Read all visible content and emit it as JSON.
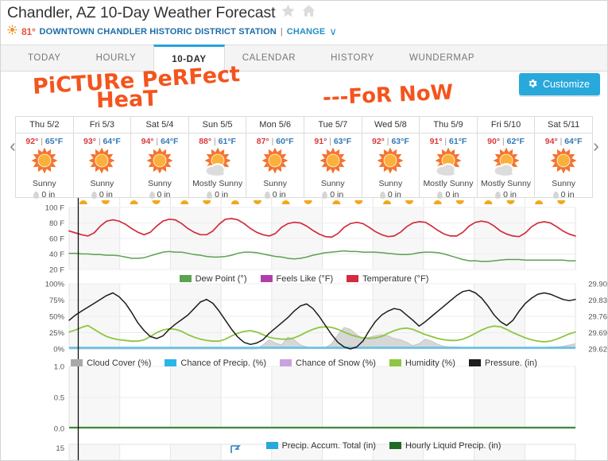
{
  "header": {
    "title": "Chandler, AZ 10-Day Weather Forecast",
    "star_icon": "star-icon",
    "home_icon": "home-icon",
    "current_temp": "81°",
    "sun_icon": "sun-icon",
    "station": "DOWNTOWN CHANDLER HISTORIC DISTRICT STATION",
    "separator": "|",
    "change_label": "CHANGE",
    "chevron": "∨"
  },
  "tabs": [
    {
      "label": "TODAY",
      "active": false
    },
    {
      "label": "HOURLY",
      "active": false
    },
    {
      "label": "10-DAY",
      "active": true
    },
    {
      "label": "CALENDAR",
      "active": false
    },
    {
      "label": "HISTORY",
      "active": false
    },
    {
      "label": "WUNDERMAP",
      "active": false
    }
  ],
  "annotations": [
    {
      "text": "PiCTURe PeRFect",
      "name": "annotation-picture-perfect"
    },
    {
      "text": "HeaT",
      "name": "annotation-heat"
    },
    {
      "text": "---FoR NoW",
      "name": "annotation-for-now"
    }
  ],
  "customize": {
    "label": "Customize",
    "icon": "gear-icon",
    "color": "#29a8dc"
  },
  "nav": {
    "prev": "‹",
    "next": "›"
  },
  "forecast": {
    "precip_unit": "0 in",
    "days": [
      {
        "day": "Thu 5/2",
        "high": "92°",
        "low": "65°F",
        "cond": "Sunny",
        "icon": "sunny-icon",
        "precip": "0 in"
      },
      {
        "day": "Fri 5/3",
        "high": "93°",
        "low": "64°F",
        "cond": "Sunny",
        "icon": "sunny-icon",
        "precip": "0 in"
      },
      {
        "day": "Sat 5/4",
        "high": "94°",
        "low": "64°F",
        "cond": "Sunny",
        "icon": "sunny-icon",
        "precip": "0 in"
      },
      {
        "day": "Sun 5/5",
        "high": "88°",
        "low": "61°F",
        "cond": "Mostly Sunny",
        "icon": "mostly-sunny-icon",
        "precip": "0 in"
      },
      {
        "day": "Mon 5/6",
        "high": "87°",
        "low": "60°F",
        "cond": "Sunny",
        "icon": "sunny-icon",
        "precip": "0 in"
      },
      {
        "day": "Tue 5/7",
        "high": "91°",
        "low": "63°F",
        "cond": "Sunny",
        "icon": "sunny-icon",
        "precip": "0 in"
      },
      {
        "day": "Wed 5/8",
        "high": "92°",
        "low": "63°F",
        "cond": "Sunny",
        "icon": "sunny-icon",
        "precip": "0 in"
      },
      {
        "day": "Thu 5/9",
        "high": "91°",
        "low": "61°F",
        "cond": "Mostly Sunny",
        "icon": "mostly-sunny-icon",
        "precip": "0 in"
      },
      {
        "day": "Fri 5/10",
        "high": "90°",
        "low": "62°F",
        "cond": "Mostly Sunny",
        "icon": "mostly-sunny-icon",
        "precip": "0 in"
      },
      {
        "day": "Sat 5/11",
        "high": "94°",
        "low": "64°F",
        "cond": "Sunny",
        "icon": "sunny-icon",
        "precip": "0 in"
      }
    ]
  },
  "chart_data": [
    {
      "type": "line",
      "name": "temperature-chart",
      "title": "",
      "xlabel": "",
      "ylabel": "",
      "ylim": [
        10,
        110
      ],
      "yticks": [
        20,
        40,
        60,
        80,
        100
      ],
      "ytick_labels": [
        "20 F",
        "40 F",
        "60 F",
        "80 F",
        "100 F"
      ],
      "grid": true,
      "legend_position": "bottom",
      "series": [
        {
          "name": "Temperature (°F)",
          "color": "#d22c3e",
          "values": [
            72,
            69,
            66,
            64,
            69,
            80,
            88,
            90,
            88,
            83,
            76,
            70,
            66,
            70,
            80,
            88,
            91,
            90,
            84,
            76,
            70,
            66,
            66,
            72,
            83,
            91,
            92,
            90,
            84,
            76,
            70,
            66,
            64,
            68,
            78,
            84,
            86,
            85,
            80,
            73,
            67,
            63,
            62,
            68,
            78,
            84,
            86,
            84,
            78,
            71,
            66,
            63,
            64,
            70,
            79,
            85,
            87,
            86,
            80,
            73,
            67,
            64,
            64,
            70,
            80,
            86,
            88,
            86,
            80,
            72,
            67,
            64,
            63,
            69,
            79,
            85,
            87,
            85,
            79,
            72,
            67,
            64
          ]
        },
        {
          "name": "Feels Like (°F)",
          "color": "#b13fa8",
          "values": []
        },
        {
          "name": "Dew Point (°)",
          "color": "#5aa34f",
          "values": [
            36,
            36,
            35,
            35,
            34,
            34,
            33,
            33,
            32,
            30,
            28,
            28,
            29,
            32,
            35,
            38,
            39,
            38,
            38,
            36,
            34,
            33,
            31,
            30,
            30,
            31,
            33,
            36,
            38,
            38,
            37,
            35,
            33,
            31,
            30,
            28,
            27,
            28,
            30,
            33,
            35,
            37,
            38,
            39,
            40,
            39,
            39,
            38,
            38,
            38,
            37,
            36,
            35,
            34,
            34,
            35,
            37,
            38,
            38,
            37,
            35,
            32,
            29,
            26,
            24,
            24,
            23,
            23,
            24,
            25,
            26,
            26,
            26,
            25,
            25,
            25,
            25,
            25,
            25,
            25,
            24,
            24
          ]
        }
      ]
    },
    {
      "type": "line",
      "name": "humidity-pressure-chart",
      "ylim_left": [
        0,
        100
      ],
      "yticks_left": [
        0,
        25,
        50,
        75,
        100
      ],
      "ytick_labels_left": [
        "0%",
        "25%",
        "50%",
        "75%",
        "100%"
      ],
      "ylim_right": [
        29.62,
        29.9
      ],
      "ytick_labels_right": [
        "29.90",
        "29.83",
        "29.76",
        "29.69",
        "29.62"
      ],
      "grid": true,
      "legend_position": "bottom",
      "series": [
        {
          "name": "Cloud Cover (%)",
          "color": "#b6b6b6",
          "type": "area",
          "values": [
            0,
            0,
            0,
            0,
            0,
            0,
            0,
            0,
            0,
            0,
            0,
            0,
            0,
            0,
            0,
            0,
            0,
            0,
            0,
            0,
            0,
            0,
            0,
            0,
            0,
            0,
            0,
            0,
            0,
            0,
            0,
            6,
            14,
            9,
            6,
            18,
            14,
            6,
            3,
            2,
            1,
            2,
            8,
            22,
            33,
            30,
            22,
            16,
            18,
            20,
            22,
            20,
            16,
            14,
            10,
            5,
            8,
            15,
            12,
            7,
            4,
            3,
            3,
            2,
            2,
            1,
            1,
            1,
            1,
            1,
            1,
            2,
            2,
            2,
            2,
            2,
            2,
            3,
            3,
            4,
            6,
            8
          ]
        },
        {
          "name": "Chance of Precip. (%)",
          "color": "#29b5e8",
          "type": "line",
          "values": []
        },
        {
          "name": "Chance of Snow (%)",
          "color": "#c9a2dd",
          "type": "line",
          "values": []
        },
        {
          "name": "Humidity (%)",
          "color": "#8dc63f",
          "type": "line",
          "values": [
            26,
            29,
            33,
            36,
            30,
            24,
            19,
            16,
            14,
            13,
            12,
            12,
            14,
            19,
            25,
            29,
            31,
            30,
            27,
            22,
            18,
            15,
            13,
            12,
            12,
            15,
            20,
            24,
            27,
            28,
            26,
            22,
            18,
            16,
            15,
            15,
            17,
            21,
            26,
            30,
            33,
            34,
            33,
            30,
            26,
            22,
            19,
            17,
            16,
            17,
            19,
            24,
            28,
            31,
            32,
            30,
            26,
            22,
            19,
            16,
            14,
            13,
            13,
            15,
            19,
            24,
            29,
            33,
            35,
            34,
            30,
            25,
            21,
            17,
            14,
            12,
            11,
            12,
            15,
            19,
            23,
            26
          ]
        },
        {
          "name": "Pressure. (in)",
          "color": "#1c1c1c",
          "type": "line",
          "values": [
            44,
            52,
            58,
            64,
            70,
            76,
            82,
            86,
            80,
            70,
            56,
            40,
            28,
            19,
            16,
            20,
            30,
            38,
            45,
            52,
            62,
            72,
            76,
            70,
            58,
            44,
            30,
            18,
            10,
            7,
            9,
            14,
            24,
            32,
            40,
            48,
            58,
            66,
            69,
            62,
            50,
            36,
            22,
            10,
            3,
            0,
            3,
            12,
            28,
            42,
            52,
            58,
            62,
            60,
            52,
            44,
            35,
            42,
            50,
            58,
            66,
            74,
            82,
            88,
            90,
            86,
            78,
            66,
            52,
            42,
            36,
            44,
            58,
            70,
            78,
            84,
            86,
            84,
            80,
            76,
            74,
            76
          ]
        }
      ]
    },
    {
      "type": "line",
      "name": "precipitation-chart",
      "ylim": [
        0,
        1.0
      ],
      "yticks": [
        0.0,
        0.5,
        1.0
      ],
      "ytick_labels": [
        "0.0",
        "0.5",
        "1.0"
      ],
      "grid": true,
      "legend_position": "bottom",
      "series": [
        {
          "name": "Precip. Accum. Total (in)",
          "color": "#29a8dc",
          "values": []
        },
        {
          "name": "Hourly Liquid Precip. (in)",
          "color": "#2e7d32",
          "values": [
            0,
            0,
            0,
            0,
            0,
            0,
            0,
            0,
            0,
            0,
            0,
            0,
            0,
            0,
            0,
            0,
            0,
            0,
            0,
            0,
            0,
            0,
            0,
            0,
            0,
            0,
            0,
            0,
            0,
            0,
            0,
            0,
            0,
            0,
            0,
            0,
            0,
            0,
            0,
            0,
            0,
            0,
            0,
            0,
            0,
            0,
            0,
            0,
            0,
            0,
            0,
            0,
            0,
            0,
            0,
            0,
            0,
            0,
            0,
            0,
            0,
            0,
            0,
            0,
            0,
            0,
            0,
            0,
            0,
            0,
            0,
            0,
            0,
            0,
            0,
            0,
            0,
            0,
            0,
            0,
            0,
            0
          ]
        }
      ]
    },
    {
      "type": "line",
      "name": "wind-chart",
      "yticks": [
        15
      ],
      "ytick_labels": [
        "15"
      ],
      "series": []
    }
  ],
  "legends": {
    "temperature": [
      {
        "label": "Dew Point (°)",
        "color": "#5aa34f"
      },
      {
        "label": "Feels Like (°F)",
        "color": "#b13fa8"
      },
      {
        "label": "Temperature (°F)",
        "color": "#d22c3e"
      }
    ],
    "humidity": [
      {
        "label": "Cloud Cover (%)",
        "color": "#a9a9a9"
      },
      {
        "label": "Chance of Precip. (%)",
        "color": "#29b5e8"
      },
      {
        "label": "Chance of Snow (%)",
        "color": "#c9a2dd"
      },
      {
        "label": "Humidity (%)",
        "color": "#8dc63f"
      },
      {
        "label": "Pressure. (in)",
        "color": "#1c1c1c"
      }
    ],
    "precip": [
      {
        "label": "Precip. Accum. Total (in)",
        "color": "#29a8dc"
      },
      {
        "label": "Hourly Liquid Precip. (in)",
        "color": "#1f6b2a"
      }
    ]
  }
}
